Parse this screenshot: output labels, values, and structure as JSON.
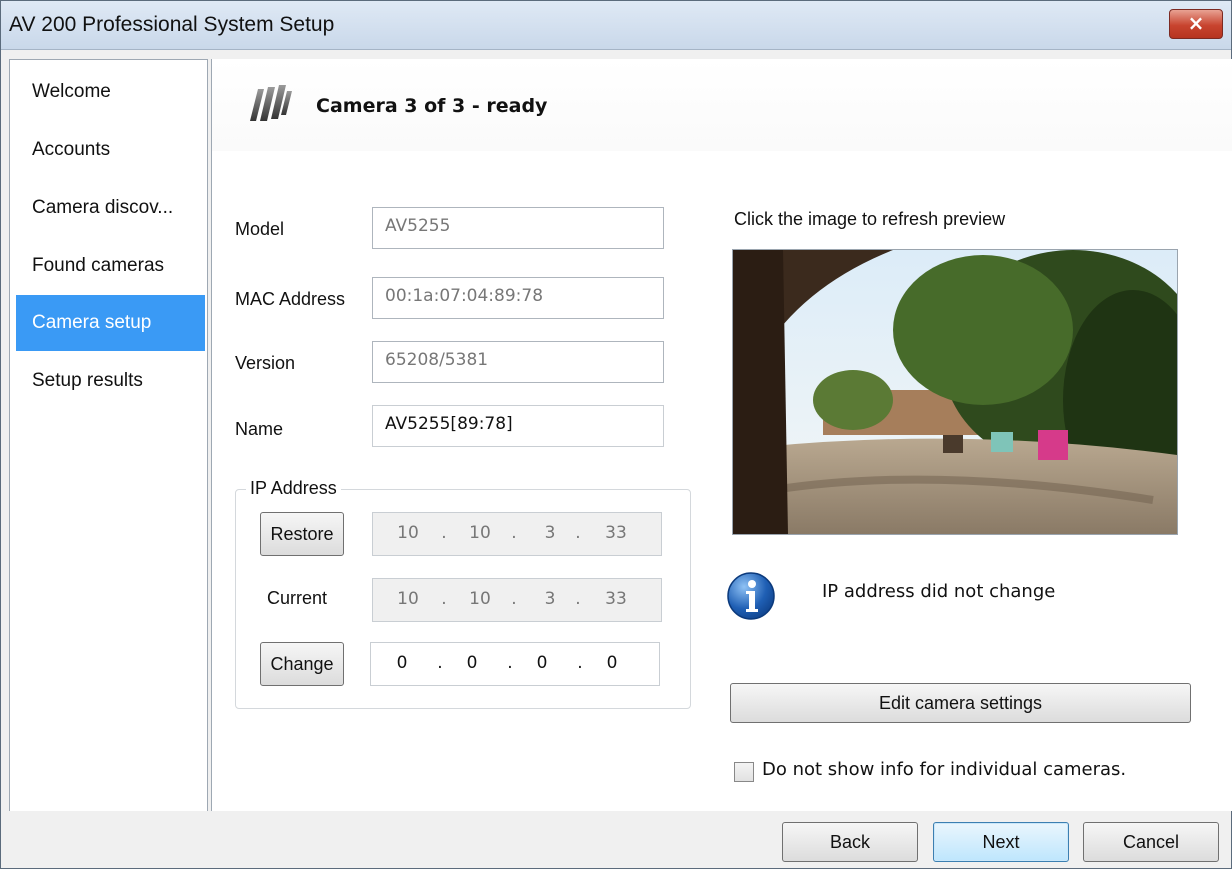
{
  "window": {
    "title": "AV 200 Professional System Setup",
    "close_label": "×"
  },
  "sidebar": {
    "selected_index": 4,
    "items": [
      {
        "label": "Welcome"
      },
      {
        "label": "Accounts"
      },
      {
        "label": "Camera discov..."
      },
      {
        "label": "Found cameras"
      },
      {
        "label": "Camera setup"
      },
      {
        "label": "Setup results"
      }
    ]
  },
  "header": {
    "title": "Camera 3 of 3 - ready",
    "logo_icon": "brand-logo-icon"
  },
  "form": {
    "model_label": "Model",
    "model_value": "AV5255",
    "mac_label": "MAC Address",
    "mac_value": "00:1a:07:04:89:78",
    "version_label": "Version",
    "version_value": "65208/5381",
    "name_label": "Name",
    "name_value": "AV5255[89:78]"
  },
  "ip": {
    "group_label": "IP Address",
    "restore_label": "Restore",
    "restore_value": [
      "10",
      "10",
      "3",
      "33"
    ],
    "current_label": "Current",
    "current_value": [
      "10",
      "10",
      "3",
      "33"
    ],
    "change_label": "Change",
    "change_value": [
      "0",
      "0",
      "0",
      "0"
    ]
  },
  "preview": {
    "caption": "Click the image to refresh preview"
  },
  "info": {
    "icon": "info-icon",
    "message": "IP address did not change"
  },
  "edit_button": "Edit camera settings",
  "checkbox": {
    "label": "Do not show info for individual cameras.",
    "checked": false
  },
  "footer": {
    "back": "Back",
    "next": "Next",
    "cancel": "Cancel"
  },
  "colors": {
    "selected_nav": "#3a9af5",
    "close_button": "#c8442f",
    "info_blue": "#1f5fb4"
  }
}
